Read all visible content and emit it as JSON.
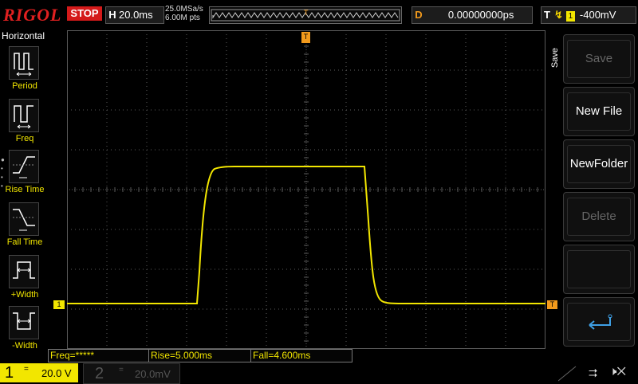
{
  "brand": "RIGOL",
  "run_state": "STOP",
  "horizontal": {
    "key": "H",
    "timebase": "20.0ms"
  },
  "acquisition": {
    "sample_rate": "25.0MSa/s",
    "memory_depth": "6.00M pts"
  },
  "delay": {
    "key": "D",
    "value": "0.00000000ps"
  },
  "trigger": {
    "key": "T",
    "source": "1",
    "level": "-400mV"
  },
  "left_menu": {
    "title": "Horizontal",
    "items": [
      {
        "label": "Period",
        "icon": "period-icon"
      },
      {
        "label": "Freq",
        "icon": "frequency-icon"
      },
      {
        "label": "Rise Time",
        "icon": "rise-time-icon"
      },
      {
        "label": "Fall Time",
        "icon": "fall-time-icon"
      },
      {
        "label": "+Width",
        "icon": "positive-width-icon"
      },
      {
        "label": "-Width",
        "icon": "negative-width-icon"
      }
    ]
  },
  "right_menu": {
    "title": "Save",
    "buttons": [
      {
        "label": "Save",
        "enabled": false
      },
      {
        "label": "New File",
        "enabled": true
      },
      {
        "label": "NewFolder",
        "enabled": true
      },
      {
        "label": "Delete",
        "enabled": false
      },
      {
        "label": "",
        "icon": "return-arrow-icon"
      }
    ]
  },
  "measurements": [
    {
      "text": "Freq=*****"
    },
    {
      "text": "Rise=5.000ms"
    },
    {
      "text": "Fall=4.600ms"
    }
  ],
  "channels": [
    {
      "number": "1",
      "coupling": "=",
      "scale": "20.0 V",
      "active": true
    },
    {
      "number": "2",
      "coupling": "=",
      "scale": "20.0mV",
      "active": false
    }
  ],
  "markers": {
    "ch1_marker": "1",
    "trigger_level_marker": "T",
    "trigger_position_marker": "T"
  },
  "colors": {
    "ch1": "#f2e600",
    "stop": "#d41a1a",
    "delay_key": "#f29a1c",
    "trigger_marker": "#f29a1c",
    "grid": "#5a5a5a"
  }
}
